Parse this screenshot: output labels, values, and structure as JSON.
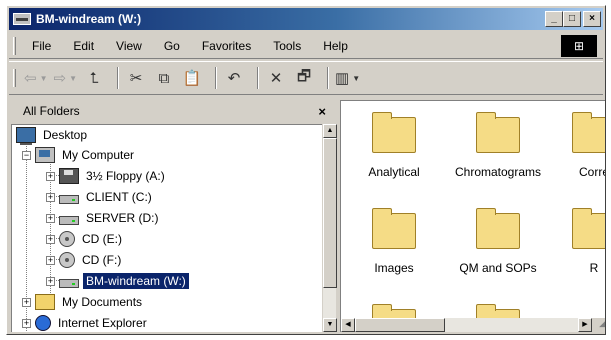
{
  "window": {
    "title": "BM-windream (W:)",
    "buttons": {
      "minimize": "_",
      "maximize": "□",
      "close": "×"
    }
  },
  "menubar": {
    "items": [
      {
        "label": "File",
        "icon": ""
      },
      {
        "label": "Edit"
      },
      {
        "label": "View"
      },
      {
        "label": "Go"
      },
      {
        "label": "Favorites"
      },
      {
        "label": "Tools"
      },
      {
        "label": "Help"
      }
    ]
  },
  "toolbar": {
    "back": "⇦",
    "forward": "⇨",
    "up": "⮤",
    "cut": "✂",
    "copy": "⧉",
    "paste": "📋",
    "undo": "↶",
    "delete": "✕",
    "properties": "🗗",
    "views": "▥"
  },
  "folders_panel": {
    "title": "All Folders",
    "close": "×",
    "tree": [
      {
        "label": "Desktop",
        "icon": "desktop-icon",
        "expander": ""
      },
      {
        "label": "My Computer",
        "icon": "computer-icon",
        "expander": "−"
      },
      {
        "label": "3½ Floppy (A:)",
        "icon": "floppy-icon",
        "expander": "+"
      },
      {
        "label": "CLIENT (C:)",
        "icon": "drive-icon",
        "expander": "+"
      },
      {
        "label": "SERVER (D:)",
        "icon": "drive-icon",
        "expander": "+"
      },
      {
        "label": "CD (E:)",
        "icon": "cd-icon",
        "expander": "+"
      },
      {
        "label": "CD (F:)",
        "icon": "cd-icon",
        "expander": "+"
      },
      {
        "label": "BM-windream (W:)",
        "icon": "drive-icon",
        "expander": "+",
        "selected": true
      },
      {
        "label": "My Documents",
        "icon": "folder-icon",
        "expander": "+"
      },
      {
        "label": "Internet Explorer",
        "icon": "ie-icon",
        "expander": "+"
      }
    ]
  },
  "contents": {
    "items": [
      {
        "label": "Analytical"
      },
      {
        "label": "Chromatograms"
      },
      {
        "label": "Corre"
      },
      {
        "label": "Images"
      },
      {
        "label": "QM and SOPs"
      },
      {
        "label": "R"
      }
    ]
  }
}
